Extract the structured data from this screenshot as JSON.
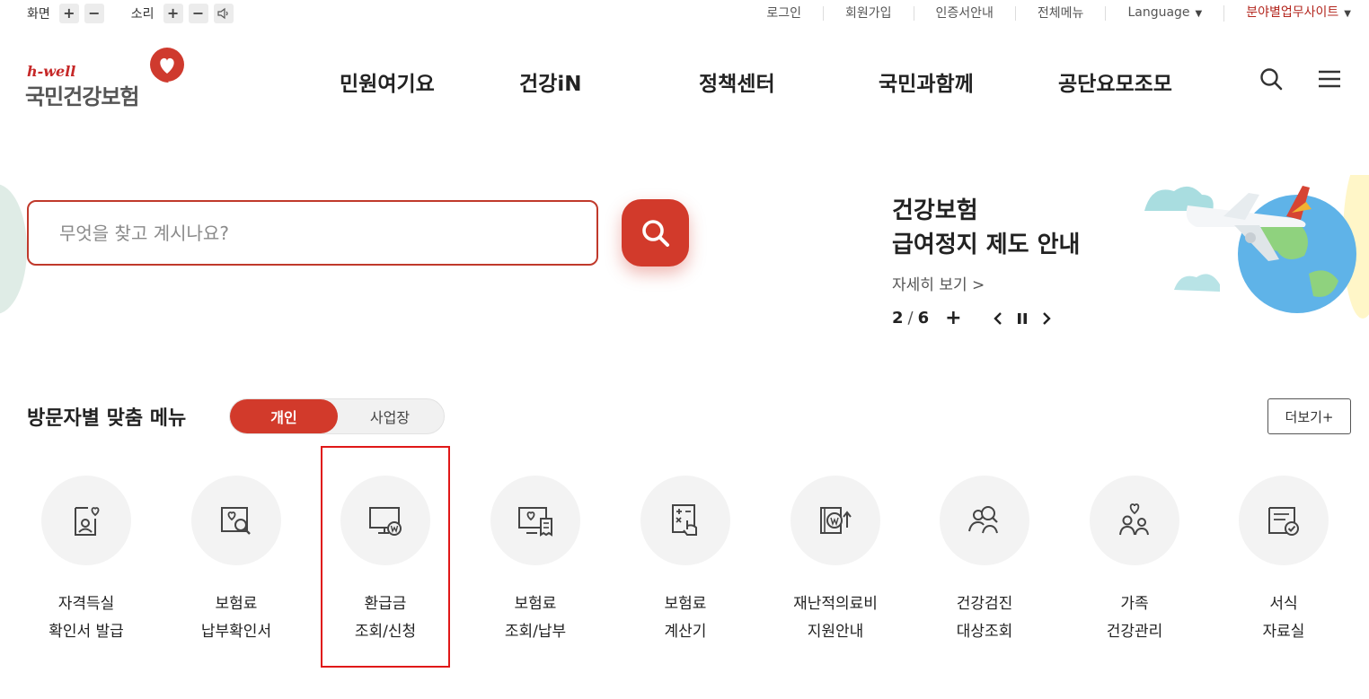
{
  "utility": {
    "screen_label": "화면",
    "sound_label": "소리",
    "links": [
      "로그인",
      "회원가입",
      "인증서안내",
      "전체메뉴"
    ],
    "language": "Language",
    "field_sites": "분야별업무사이트"
  },
  "logo": {
    "small": "h-well",
    "big": "국민건강보험"
  },
  "nav": [
    "민원여기요",
    "건강iN",
    "정책센터",
    "국민과함께",
    "공단요모조모"
  ],
  "search": {
    "placeholder": "무엇을 찾고 계시나요?"
  },
  "banner": {
    "title_line1": "건강보험",
    "title_line2": "급여정지 제도 안내",
    "more": "자세히 보기 >",
    "current": "2",
    "total": "6"
  },
  "section": {
    "title": "방문자별 맞춤 메뉴",
    "tab_personal": "개인",
    "tab_business": "사업장",
    "more": "더보기+"
  },
  "quick_menu": [
    {
      "line1": "자격득실",
      "line2": "확인서 발급",
      "icon": "id-card-heart-icon"
    },
    {
      "line1": "보험료",
      "line2": "납부확인서",
      "icon": "document-search-icon"
    },
    {
      "line1": "환급금",
      "line2": "조회/신청",
      "icon": "monitor-won-icon"
    },
    {
      "line1": "보험료",
      "line2": "조회/납부",
      "icon": "monitor-receipt-icon"
    },
    {
      "line1": "보험료",
      "line2": "계산기",
      "icon": "calculator-hand-icon"
    },
    {
      "line1": "재난적의료비",
      "line2": "지원안내",
      "icon": "coin-arrow-up-icon"
    },
    {
      "line1": "건강검진",
      "line2": "대상조회",
      "icon": "person-search-icon"
    },
    {
      "line1": "가족",
      "line2": "건강관리",
      "icon": "family-heart-icon"
    },
    {
      "line1": "서식",
      "line2": "자료실",
      "icon": "document-check-icon"
    }
  ],
  "colors": {
    "accent": "#d23a2b",
    "highlight": "#e01818",
    "circle_bg": "#f3f3f3"
  }
}
